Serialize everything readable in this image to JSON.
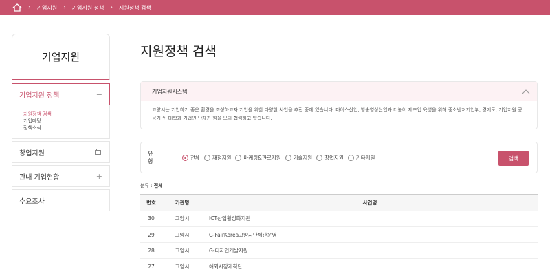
{
  "breadcrumb": [
    "기업지원",
    "기업지원 정책",
    "지원정책 검색"
  ],
  "sidebar": {
    "title": "기업지원",
    "items": [
      {
        "label": "기업지원 정책",
        "icon": "minus-icon",
        "active": true,
        "sub": [
          "지원정책 검색",
          "기업마당",
          "정책소식"
        ]
      },
      {
        "label": "창업지원",
        "icon": "window-icon"
      },
      {
        "label": "관내 기업현황",
        "icon": "plus-icon"
      },
      {
        "label": "수요조사"
      }
    ]
  },
  "main": {
    "title": "지원정책 검색",
    "info": {
      "title": "기업지원시스템",
      "body": "고양시는 기업하기 좋은 환경을 조성하고자 기업을 위한 다양한 사업을 추진 중에 있습니다. 마이스산업, 방송영상산업과 더불어 제조업 육성을 위해 중소벤처기업부, 경기도, 기업지원 공공기관, 대학과 기업인 단체가 힘을 모아 협력하고 있습니다."
    },
    "filter": {
      "label": "유형",
      "options": [
        "전체",
        "재정지원",
        "마케팅&판로지원",
        "기술지원",
        "창업지원",
        "기타지원"
      ],
      "selected": "전체",
      "search_label": "검색"
    },
    "category": {
      "prefix": "분류 : ",
      "value": "전체"
    },
    "table": {
      "headers": [
        "번호",
        "기관명",
        "사업명"
      ],
      "rows": [
        [
          "30",
          "고양시",
          "ICT산업활성화지원"
        ],
        [
          "29",
          "고양시",
          "G-FairKorea고양시단체관운영"
        ],
        [
          "28",
          "고양시",
          "G-디자인개발지원"
        ],
        [
          "27",
          "고양시",
          "해외시장개척단"
        ]
      ]
    }
  },
  "colors": {
    "accent": "#c8526c",
    "info_bg": "#fdf2f4"
  }
}
